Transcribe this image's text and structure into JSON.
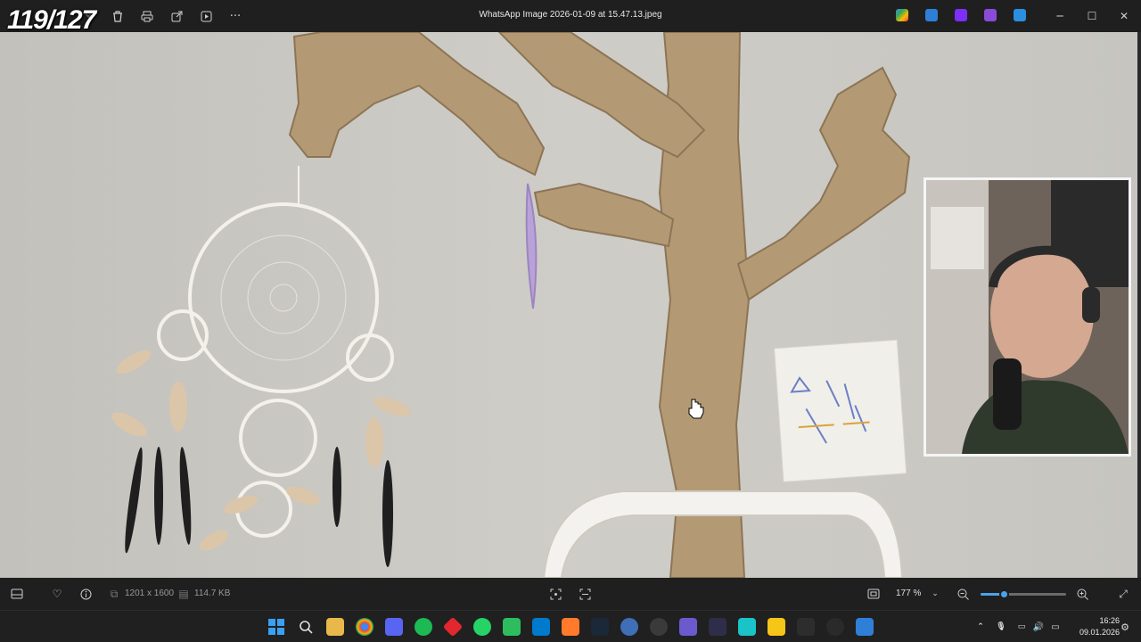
{
  "overlay": {
    "counter": "119/127"
  },
  "window": {
    "title": "WhatsApp Image 2026-01-09 at 15.47.13.jpeg"
  },
  "toolbar": {
    "icons": [
      "edit-icon",
      "delete-icon",
      "print-icon",
      "share-icon",
      "slideshow-icon",
      "more-icon"
    ],
    "more_label": "···"
  },
  "window_controls": {
    "minimize": "─",
    "maximize": "☐",
    "close": "✕"
  },
  "bottom": {
    "dimensions": "1201 x 1600",
    "file_size": "114.7 KB",
    "zoom": "177 %",
    "zoom_level": 0.27
  },
  "clock": {
    "time": "16:26",
    "date": "09.01.2026"
  },
  "colors": {
    "accent": "#4ca3e8",
    "background": "#1f1f1f",
    "wall": "#c9c8c3",
    "paper": "#b49a74"
  }
}
